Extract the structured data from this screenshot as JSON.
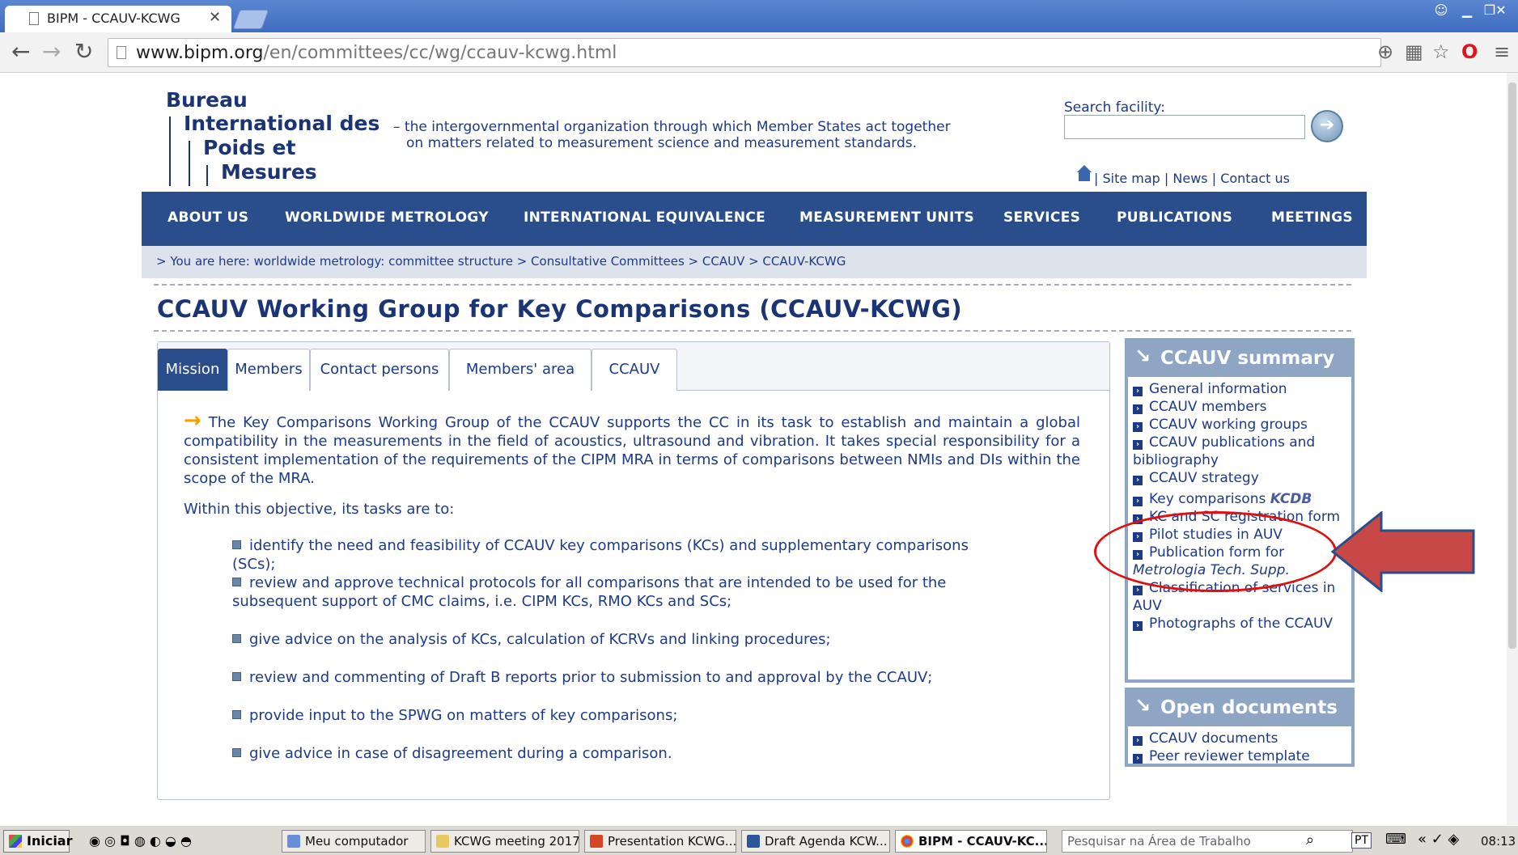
{
  "browser": {
    "tab_title": "BIPM - CCAUV-KCWG",
    "url_host": "www.bipm.org",
    "url_path": "/en/committees/cc/wg/ccauv-kcwg.html"
  },
  "header": {
    "logo_lines": [
      "Bureau",
      "International des",
      "Poids et",
      "Mesures"
    ],
    "tagline_1": "– the intergovernmental organization through which Member States act together",
    "tagline_2": "on matters related to measurement science and measurement standards.",
    "search_label": "Search facility:",
    "links": [
      "Site map",
      "News",
      "Contact us"
    ]
  },
  "nav": [
    "ABOUT US",
    "WORLDWIDE METROLOGY",
    "INTERNATIONAL EQUIVALENCE",
    "MEASUREMENT UNITS",
    "SERVICES",
    "PUBLICATIONS",
    "MEETINGS"
  ],
  "breadcrumb": "> You are here: worldwide metrology: committee structure > Consultative Committees > CCAUV > CCAUV-KCWG",
  "title": "CCAUV Working Group for Key Comparisons (CCAUV-KCWG)",
  "tabs": [
    "Mission",
    "Members",
    "Contact persons",
    "Members' area",
    "CCAUV"
  ],
  "mission": {
    "intro": "The Key Comparisons Working Group of the CCAUV supports the CC in its task to establish and maintain a global compatibility in the measurements in the field of acoustics, ultrasound and vibration. It takes special responsibility for a consistent implementation of the requirements of the CIPM MRA in terms of comparisons between NMIs and DIs within the scope of the MRA.",
    "objective": "Within this objective, its tasks are to:",
    "tasks": [
      "identify the need and feasibility of CCAUV key comparisons (KCs) and supplementary comparisons (SCs);",
      "review and approve technical protocols for all comparisons that are intended to be used for the subsequent support of CMC claims, i.e. CIPM KCs, RMO KCs and SCs;",
      "give advice on the analysis of KCs, calculation of KCRVs and linking procedures;",
      "review and commenting of Draft B reports prior to submission to and approval by the CCAUV;",
      "provide input to the SPWG on matters of key comparisons;",
      "give advice in case of disagreement during a comparison."
    ]
  },
  "summary": {
    "heading": "CCAUV summary",
    "items": [
      "General information",
      "CCAUV members",
      "CCAUV working groups",
      "CCAUV publications and bibliography",
      "CCAUV strategy",
      "Key comparisons",
      "KC and SC registration form",
      "Pilot studies in AUV",
      "Publication form for",
      "Classification of services in AUV",
      "Photographs of the CCAUV"
    ],
    "kcdb_badge": "KCDB",
    "publication_suffix": "Metrologia Tech. Supp."
  },
  "open_docs": {
    "heading": "Open documents",
    "items": [
      "CCAUV documents",
      "Peer reviewer template"
    ]
  },
  "taskbar": {
    "start": "Iniciar",
    "items": [
      "Meu computador",
      "KCWG meeting 2017",
      "Presentation KCWG...",
      "Draft Agenda KCW...",
      "BIPM - CCAUV-KC..."
    ],
    "search_placeholder": "Pesquisar na Área de Trabalho",
    "lang": "PT",
    "time": "08:13"
  },
  "colors": {
    "nav_bg": "#2a4d8c",
    "text": "#1d3a86",
    "annotation": "#e01010"
  }
}
